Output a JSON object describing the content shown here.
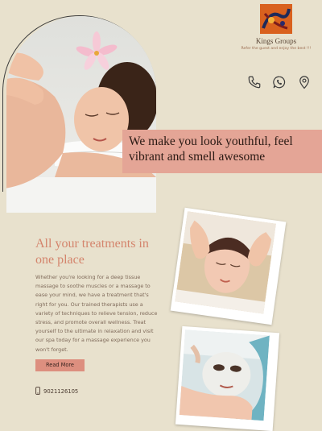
{
  "brand": {
    "name": "Kings Groups",
    "tagline": "Refer the guest and enjoy the best !!!"
  },
  "header": {
    "icons": [
      "phone-icon",
      "whatsapp-icon",
      "location-icon"
    ]
  },
  "hero": {
    "headline": "We make you look youthful, feel vibrant and smell awesome"
  },
  "treatments": {
    "title": "All your treatments in one place",
    "body": "Whether you're looking for a deep tissue massage to soothe muscles or a massage to ease your mind, we have a treatment that's right for you. Our trained therapists use a variety of techniques to relieve tension, reduce stress, and promote overall wellness. Treat yourself to the ultimate in relaxation and visit our spa today for a massage experience you won't forget.",
    "button_label": "Read More",
    "phone": "9021126105"
  },
  "colors": {
    "background": "#e8e1cd",
    "banner": "#e4a596",
    "accent_title": "#d4846c",
    "button": "#dd8f7f",
    "logo": "#d9611e"
  }
}
